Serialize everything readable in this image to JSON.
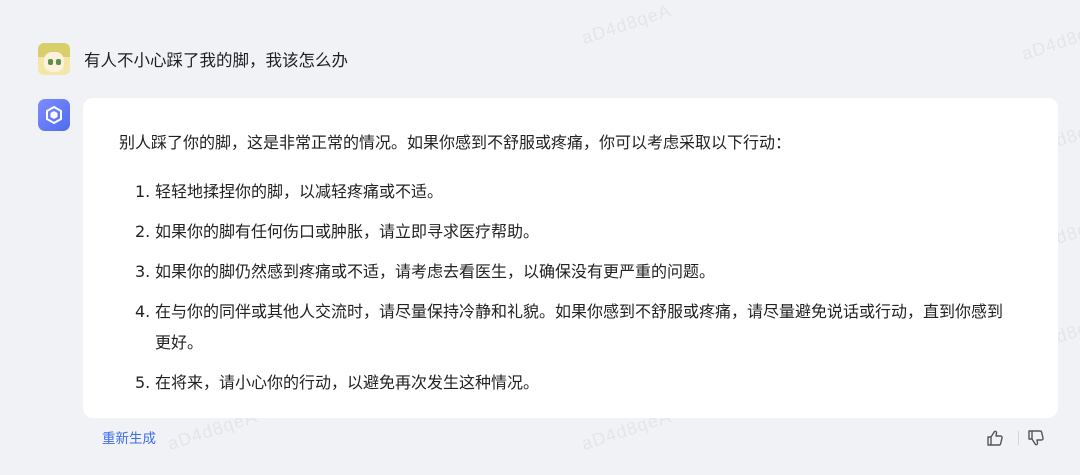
{
  "watermark": "aD4d8qeA",
  "user_message": {
    "text": "有人不小心踩了我的脚，我该怎么办"
  },
  "bot_message": {
    "intro": "别人踩了你的脚，这是非常正常的情况。如果你感到不舒服或疼痛，你可以考虑采取以下行动：",
    "items": [
      {
        "num": "1.",
        "text": "轻轻地揉捏你的脚，以减轻疼痛或不适。"
      },
      {
        "num": "2.",
        "text": "如果你的脚有任何伤口或肿胀，请立即寻求医疗帮助。"
      },
      {
        "num": "3.",
        "text": "如果你的脚仍然感到疼痛或不适，请考虑去看医生，以确保没有更严重的问题。"
      },
      {
        "num": "4.",
        "text": "在与你的同伴或其他人交流时，请尽量保持冷静和礼貌。如果你感到不舒服或疼痛，请尽量避免说话或行动，直到你感到更好。"
      },
      {
        "num": "5.",
        "text": "在将来，请小心你的行动，以避免再次发生这种情况。"
      }
    ]
  },
  "actions": {
    "regenerate_label": "重新生成"
  },
  "icons": {
    "like": "thumbs-up-icon",
    "dislike": "thumbs-down-icon",
    "bot": "bot-logo-icon",
    "user": "user-avatar"
  },
  "colors": {
    "link": "#3b6ee8",
    "bot_avatar": "#5b74f3",
    "background": "#f1f2f6"
  }
}
